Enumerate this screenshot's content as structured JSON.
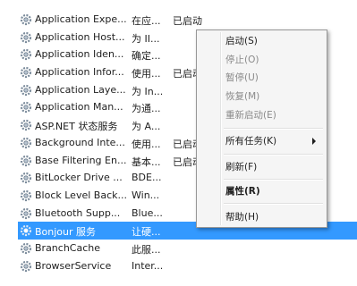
{
  "services": [
    {
      "name": "Application Expe...",
      "desc": "在应...",
      "status": "已启动"
    },
    {
      "name": "Application Host...",
      "desc": "为 II...",
      "status": ""
    },
    {
      "name": "Application Iden...",
      "desc": "确定...",
      "status": ""
    },
    {
      "name": "Application Infor...",
      "desc": "使用...",
      "status": "已启动"
    },
    {
      "name": "Application Laye...",
      "desc": "为 In...",
      "status": ""
    },
    {
      "name": "Application Man...",
      "desc": "为通...",
      "status": ""
    },
    {
      "name": "ASP.NET 状态服务",
      "desc": "为 A...",
      "status": ""
    },
    {
      "name": "Background Inte...",
      "desc": "使用...",
      "status": "已启动"
    },
    {
      "name": "Base Filtering En...",
      "desc": "基本...",
      "status": "已启动"
    },
    {
      "name": "BitLocker Drive ...",
      "desc": "BDE...",
      "status": ""
    },
    {
      "name": "Block Level Back...",
      "desc": "Win...",
      "status": ""
    },
    {
      "name": "Bluetooth Supp...",
      "desc": "Blue...",
      "status": ""
    },
    {
      "name": "Bonjour 服务",
      "desc": "让硬...",
      "status": ""
    },
    {
      "name": "BranchCache",
      "desc": "此服...",
      "status": ""
    },
    {
      "name": "BrowserService",
      "desc": "Inter...",
      "status": ""
    }
  ],
  "selected_index": 12,
  "context_menu": {
    "start": "启动(S)",
    "stop": "停止(O)",
    "pause": "暂停(U)",
    "resume": "恢复(M)",
    "restart": "重新启动(E)",
    "all_tasks": "所有任务(K)",
    "refresh": "刷新(F)",
    "properties": "属性(R)",
    "help": "帮助(H)"
  },
  "colors": {
    "selection": "#3399ff",
    "menu_bg": "#f5f5f5"
  },
  "icons": {
    "service": "gear-icon",
    "submenu": "chevron-right-icon"
  }
}
